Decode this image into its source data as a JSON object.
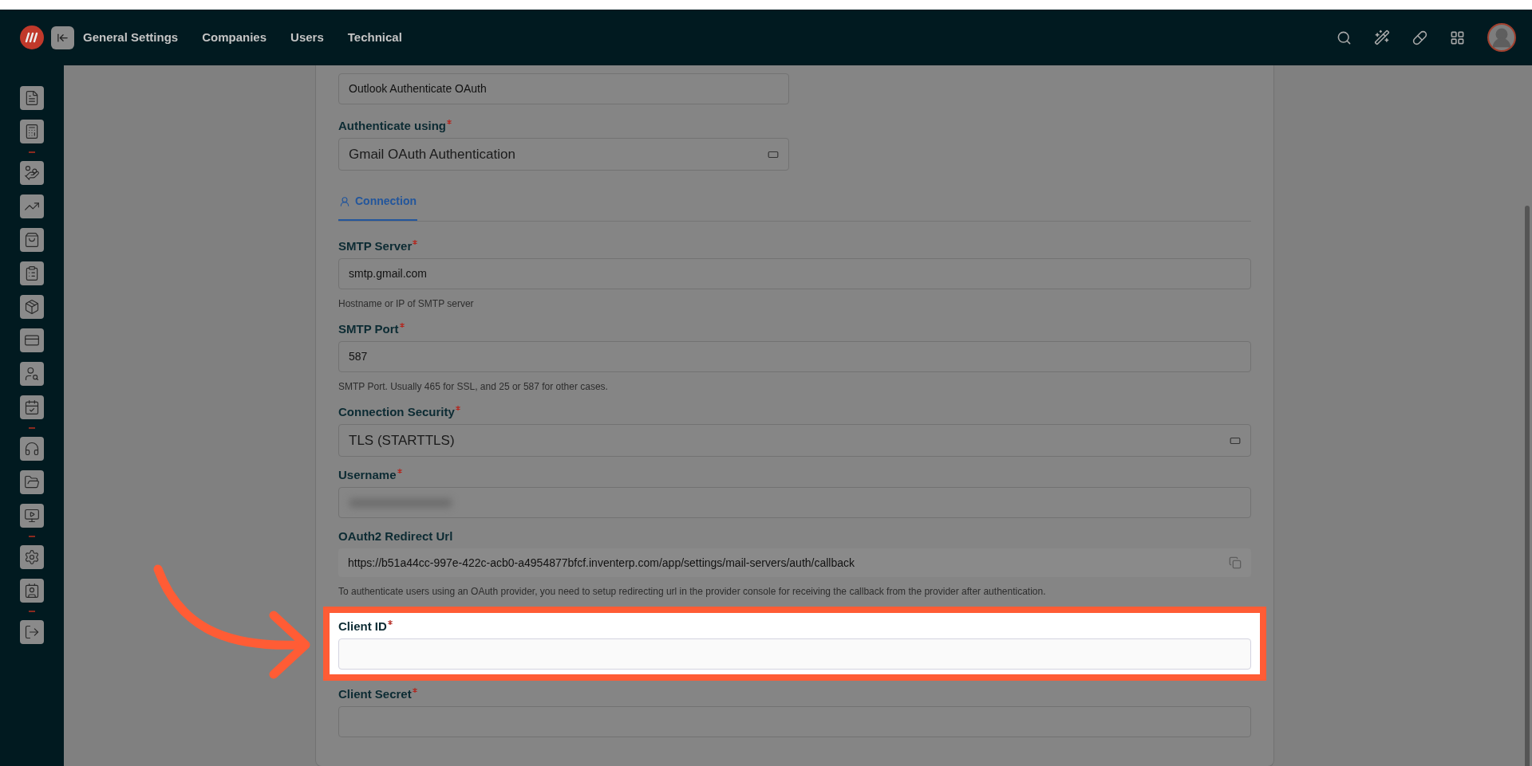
{
  "topbar": {
    "nav": [
      {
        "label": "General Settings"
      },
      {
        "label": "Companies"
      },
      {
        "label": "Users"
      },
      {
        "label": "Technical"
      }
    ]
  },
  "form": {
    "header_fields": [
      {
        "kind": "text",
        "value": "Outlook Authenticate OAuth"
      },
      {
        "kind": "select",
        "label": "Authenticate using",
        "required": true,
        "value": "Gmail OAuth Authentication"
      }
    ],
    "tabs": [
      {
        "label": "Connection",
        "selected": true
      }
    ],
    "fields": [
      {
        "kind": "text",
        "label": "SMTP Server",
        "required": true,
        "value": "smtp.gmail.com",
        "help": "Hostname or IP of SMTP server",
        "highlighted": false
      },
      {
        "kind": "text",
        "label": "SMTP Port",
        "required": true,
        "value": "587",
        "help": "SMTP Port. Usually 465 for SSL, and 25 or 587 for other cases.",
        "highlighted": false
      },
      {
        "kind": "select",
        "label": "Connection Security",
        "required": true,
        "value": "TLS (STARTTLS)",
        "highlighted": false
      },
      {
        "kind": "blurred",
        "label": "Username",
        "required": true,
        "highlighted": false
      },
      {
        "kind": "readonly",
        "label": "OAuth2 Redirect Url",
        "required": false,
        "value": "https://b51a44cc-997e-422c-acb0-a4954877bfcf.inventerp.com/app/settings/mail-servers/auth/callback",
        "help": "To authenticate users using an OAuth provider, you need to setup redirecting url in the provider console for receiving the callback from the provider after authentication.",
        "highlighted": false
      },
      {
        "kind": "text",
        "label": "Client ID",
        "required": true,
        "highlighted": true
      },
      {
        "kind": "text",
        "label": "Client Secret",
        "required": true,
        "highlighted": false
      }
    ]
  }
}
